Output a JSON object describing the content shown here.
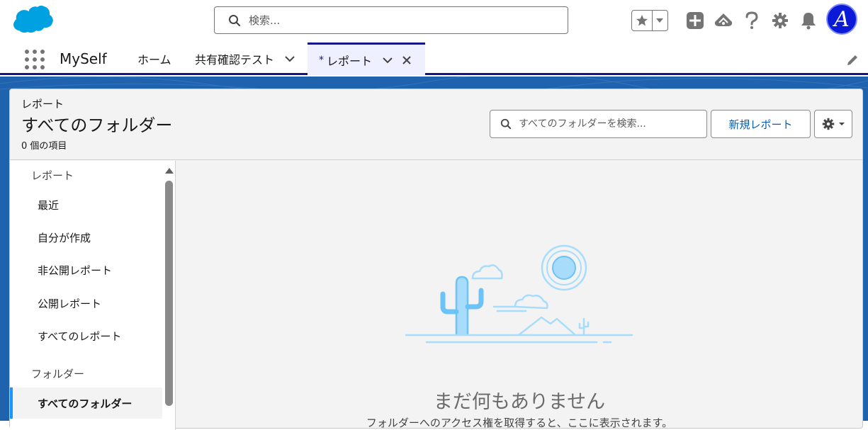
{
  "header": {
    "search_placeholder": "検索...",
    "avatar_letter": "A"
  },
  "nav": {
    "app_name": "MySelf",
    "tabs": [
      {
        "label": "ホーム"
      },
      {
        "label": "共有確認テスト"
      },
      {
        "label": "レポート",
        "marker": "*"
      }
    ]
  },
  "page": {
    "eyebrow": "レポート",
    "title": "すべてのフォルダー",
    "count": "0 個の項目",
    "search_placeholder": "すべてのフォルダーを検索...",
    "new_report_label": "新規レポート"
  },
  "sidebar": {
    "section_reports": "レポート",
    "items": [
      {
        "label": "最近"
      },
      {
        "label": "自分が作成"
      },
      {
        "label": "非公開レポート"
      },
      {
        "label": "公開レポート"
      },
      {
        "label": "すべてのレポート"
      }
    ],
    "section_folders": "フォルダー",
    "active_folder": "すべてのフォルダー"
  },
  "empty_state": {
    "title": "まだ何もありません",
    "subtitle": "フォルダーへのアクセス権を取得すると、ここに表示されます。"
  },
  "colors": {
    "brand_blue": "#14158b",
    "link_blue": "#0b5cab",
    "active_accent": "#1b96ff",
    "salesforce_cloud": "#00a1e0"
  }
}
